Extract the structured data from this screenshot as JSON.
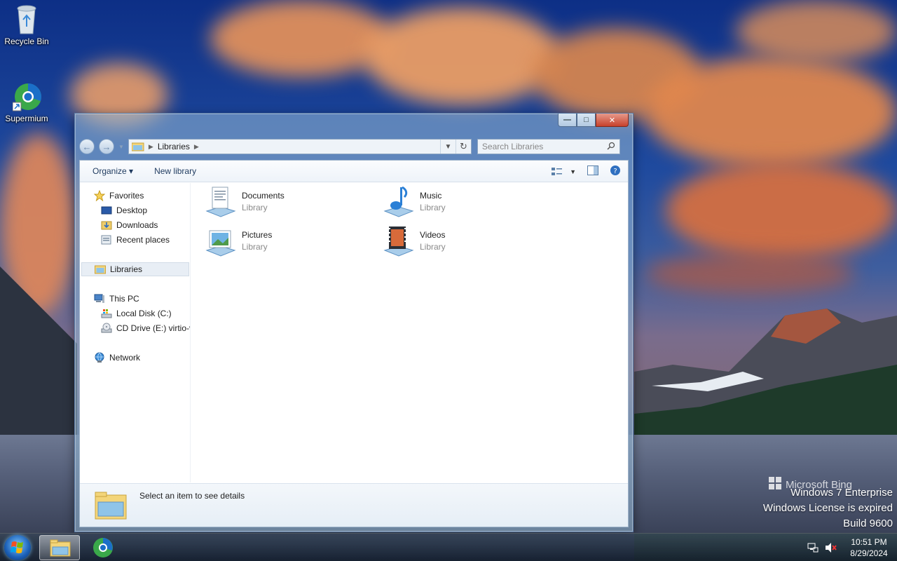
{
  "desktop": {
    "icons": [
      {
        "label": "Recycle Bin"
      },
      {
        "label": "Supermium"
      }
    ],
    "watermark": {
      "brand": "Microsoft Bing",
      "line1": "Windows 7 Enterprise",
      "line2": "Windows License is expired",
      "line3": "Build 9600"
    }
  },
  "window": {
    "caption": {
      "minimize": "—",
      "maximize": "□",
      "close": "✕"
    },
    "address": {
      "crumb": "Libraries"
    },
    "search": {
      "placeholder": "Search Libraries"
    },
    "toolbar": {
      "organize": "Organize ▾",
      "new_library": "New library"
    },
    "nav": {
      "favorites": "Favorites",
      "desktop": "Desktop",
      "downloads": "Downloads",
      "recent": "Recent places",
      "libraries": "Libraries",
      "this_pc": "This PC",
      "local_disk": "Local Disk (C:)",
      "cd_drive": "CD Drive (E:) virtio-v",
      "network": "Network"
    },
    "libraries": [
      {
        "name": "Documents",
        "type": "Library"
      },
      {
        "name": "Music",
        "type": "Library"
      },
      {
        "name": "Pictures",
        "type": "Library"
      },
      {
        "name": "Videos",
        "type": "Library"
      }
    ],
    "details": {
      "text": "Select an item to see details"
    }
  },
  "taskbar": {
    "clock": {
      "time": "10:51 PM",
      "date": "8/29/2024"
    }
  },
  "colors": {
    "accent": "#1e3a5f",
    "selection": "#e8eef5"
  }
}
